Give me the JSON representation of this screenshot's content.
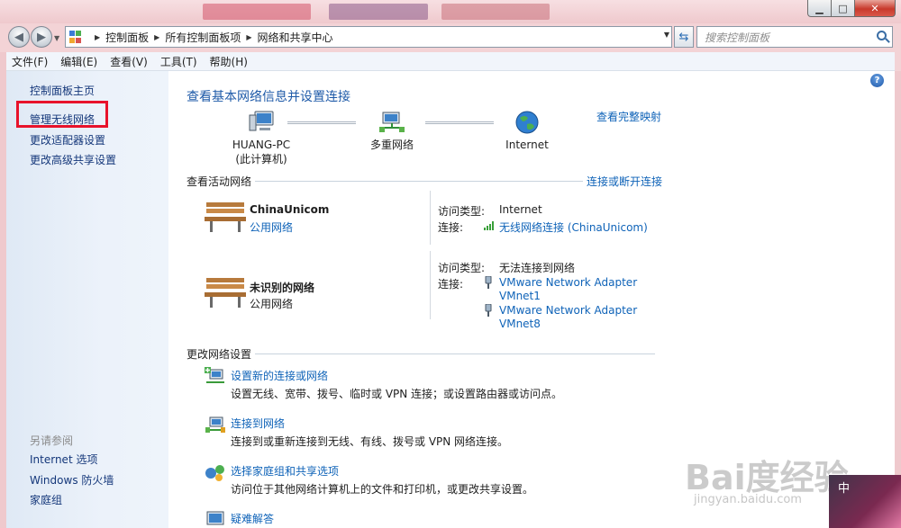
{
  "window": {
    "controls": {
      "minimize": "▁",
      "maximize": "□",
      "close": "✕"
    }
  },
  "address": {
    "crumbs": [
      "控制面板",
      "所有控制面板项",
      "网络和共享中心"
    ],
    "search_placeholder": "搜索控制面板"
  },
  "menu": [
    "文件(F)",
    "编辑(E)",
    "查看(V)",
    "工具(T)",
    "帮助(H)"
  ],
  "sidebar": {
    "links": [
      "控制面板主页",
      "管理无线网络",
      "更改适配器设置",
      "更改高级共享设置"
    ],
    "see_also_title": "另请参阅",
    "see_also": [
      "Internet 选项",
      "Windows 防火墙",
      "家庭组"
    ]
  },
  "main": {
    "heading": "查看基本网络信息并设置连接",
    "full_map": "查看完整映射",
    "map": {
      "pc_name": "HUANG-PC",
      "pc_sub": "(此计算机)",
      "middle": "多重网络",
      "internet": "Internet"
    },
    "active_title": "查看活动网络",
    "connect_disconnect": "连接或断开连接",
    "networks": [
      {
        "name": "ChinaUnicom",
        "type": "公用网络",
        "access_label": "访问类型:",
        "access_value": "Internet",
        "conn_label": "连接:",
        "conn_value": "无线网络连接 (ChinaUnicom)"
      },
      {
        "name": "未识别的网络",
        "type": "公用网络",
        "access_label": "访问类型:",
        "access_value": "无法连接到网络",
        "conn_label": "连接:",
        "adapters": [
          [
            "VMware Network Adapter",
            "VMnet1"
          ],
          [
            "VMware Network Adapter",
            "VMnet8"
          ]
        ]
      }
    ],
    "change_title": "更改网络设置",
    "tasks": [
      {
        "title": "设置新的连接或网络",
        "desc": "设置无线、宽带、拨号、临时或 VPN 连接；或设置路由器或访问点。"
      },
      {
        "title": "连接到网络",
        "desc": "连接到或重新连接到无线、有线、拨号或 VPN 网络连接。"
      },
      {
        "title": "选择家庭组和共享选项",
        "desc": "访问位于其他网络计算机上的文件和打印机，或更改共享设置。"
      },
      {
        "title": "疑难解答"
      }
    ]
  },
  "watermark": {
    "brand": "Bai度经验",
    "url": "jingyan.baidu.com"
  },
  "corner_text": "中"
}
